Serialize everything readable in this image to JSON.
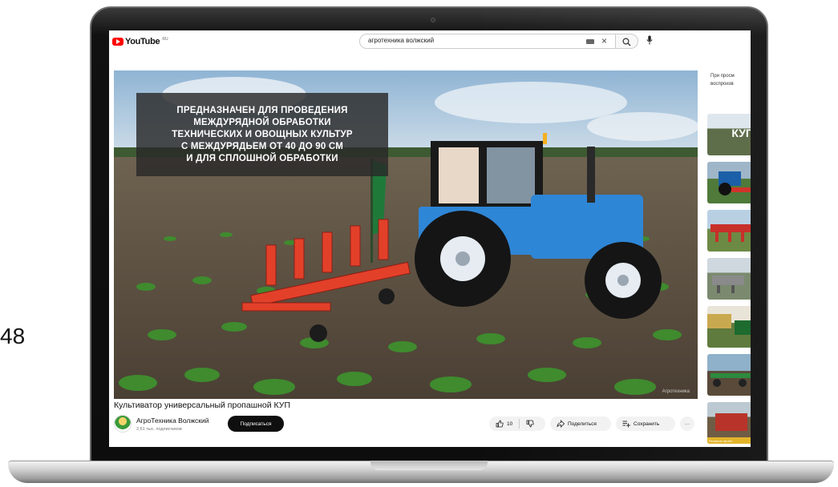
{
  "page_number": "48",
  "youtube": {
    "logo_text": "YouTube",
    "logo_region": "RU",
    "search_query": "агротехника волжский"
  },
  "video": {
    "overlay_text": "ПРЕДНАЗНАЧЕН ДЛЯ ПРОВЕДЕНИЯ\nМЕЖДУРЯДНОЙ ОБРАБОТКИ\nТЕХНИЧЕСКИХ И ОВОЩНЫХ КУЛЬТУР\nС МЕЖДУРЯДЬЕМ ОТ 40 ДО 90 СМ\nИ ДЛЯ СПЛОШНОЙ ОБРАБОТКИ",
    "watermark": "Агротехника",
    "title": "Культиватор универсальный пропашной КУП"
  },
  "channel": {
    "name": "АгроТехника Волжский",
    "subscribers": "2,61 тыс. подписчиков",
    "subscribe_label": "Подписаться"
  },
  "actions": {
    "likes": "10",
    "share_label": "Поделиться",
    "save_label": "Сохранить",
    "more_label": "···"
  },
  "sidebar": {
    "note": "При просм\nвоспроизв",
    "thumbs": [
      {
        "label": "КУП",
        "caption": ""
      },
      {
        "label": "",
        "caption": ""
      },
      {
        "label": "",
        "caption": ""
      },
      {
        "label": "",
        "caption": ""
      },
      {
        "label": "",
        "caption": ""
      },
      {
        "label": "",
        "caption": ""
      },
      {
        "label": "",
        "caption": "Решение пробл"
      }
    ]
  },
  "colors": {
    "yt_red": "#ff0000",
    "tractor_blue": "#2e86d6",
    "implement_red": "#e3402a"
  }
}
